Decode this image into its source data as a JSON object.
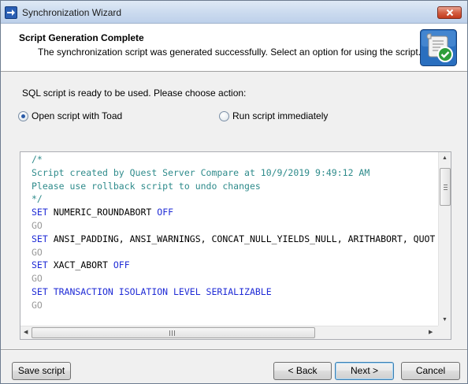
{
  "window": {
    "title": "Synchronization Wizard"
  },
  "header": {
    "title": "Script Generation Complete",
    "description": "The synchronization script was generated successfully. Select an option for using the script."
  },
  "body": {
    "info_label": "SQL script is ready to be used. Please choose action:",
    "options": [
      {
        "label": "Open script with Toad",
        "selected": true
      },
      {
        "label": "Run script immediately",
        "selected": false
      }
    ]
  },
  "script": {
    "lines": [
      {
        "text": "/*",
        "style": "comment"
      },
      {
        "text": "Script created by Quest Server Compare at 10/9/2019 9:49:12 AM",
        "style": "comment"
      },
      {
        "text": "Please use rollback script to undo changes",
        "style": "comment"
      },
      {
        "text": "*/",
        "style": "comment"
      },
      {
        "parts": [
          {
            "text": "SET",
            "style": "kw"
          },
          {
            "text": " NUMERIC_ROUNDABORT ",
            "style": "plain"
          },
          {
            "text": "OFF",
            "style": "kw"
          }
        ]
      },
      {
        "text": "GO",
        "style": "go"
      },
      {
        "parts": [
          {
            "text": "SET",
            "style": "kw"
          },
          {
            "text": " ANSI_PADDING, ANSI_WARNINGS, CONCAT_NULL_YIELDS_NULL, ARITHABORT, QUOT",
            "style": "plain"
          }
        ]
      },
      {
        "text": "GO",
        "style": "go"
      },
      {
        "parts": [
          {
            "text": "SET",
            "style": "kw"
          },
          {
            "text": " XACT_ABORT ",
            "style": "plain"
          },
          {
            "text": "OFF",
            "style": "kw"
          }
        ]
      },
      {
        "text": "GO",
        "style": "go"
      },
      {
        "parts": [
          {
            "text": "SET TRANSACTION ISOLATION LEVEL SERIALIZABLE",
            "style": "kw"
          }
        ]
      },
      {
        "text": "GO",
        "style": "go"
      }
    ]
  },
  "buttons": {
    "save_script": "Save script",
    "back": "< Back",
    "next": "Next >",
    "cancel": "Cancel"
  },
  "colors": {
    "comment": "#2e8b8b",
    "keyword": "#1f2bd6",
    "go": "#9a9a9a",
    "titlebar": "#c9d9ee",
    "close_button": "#d45f42"
  },
  "icons": {
    "app": "wizard-app-icon",
    "header": "script-check-icon",
    "close": "close-icon"
  }
}
